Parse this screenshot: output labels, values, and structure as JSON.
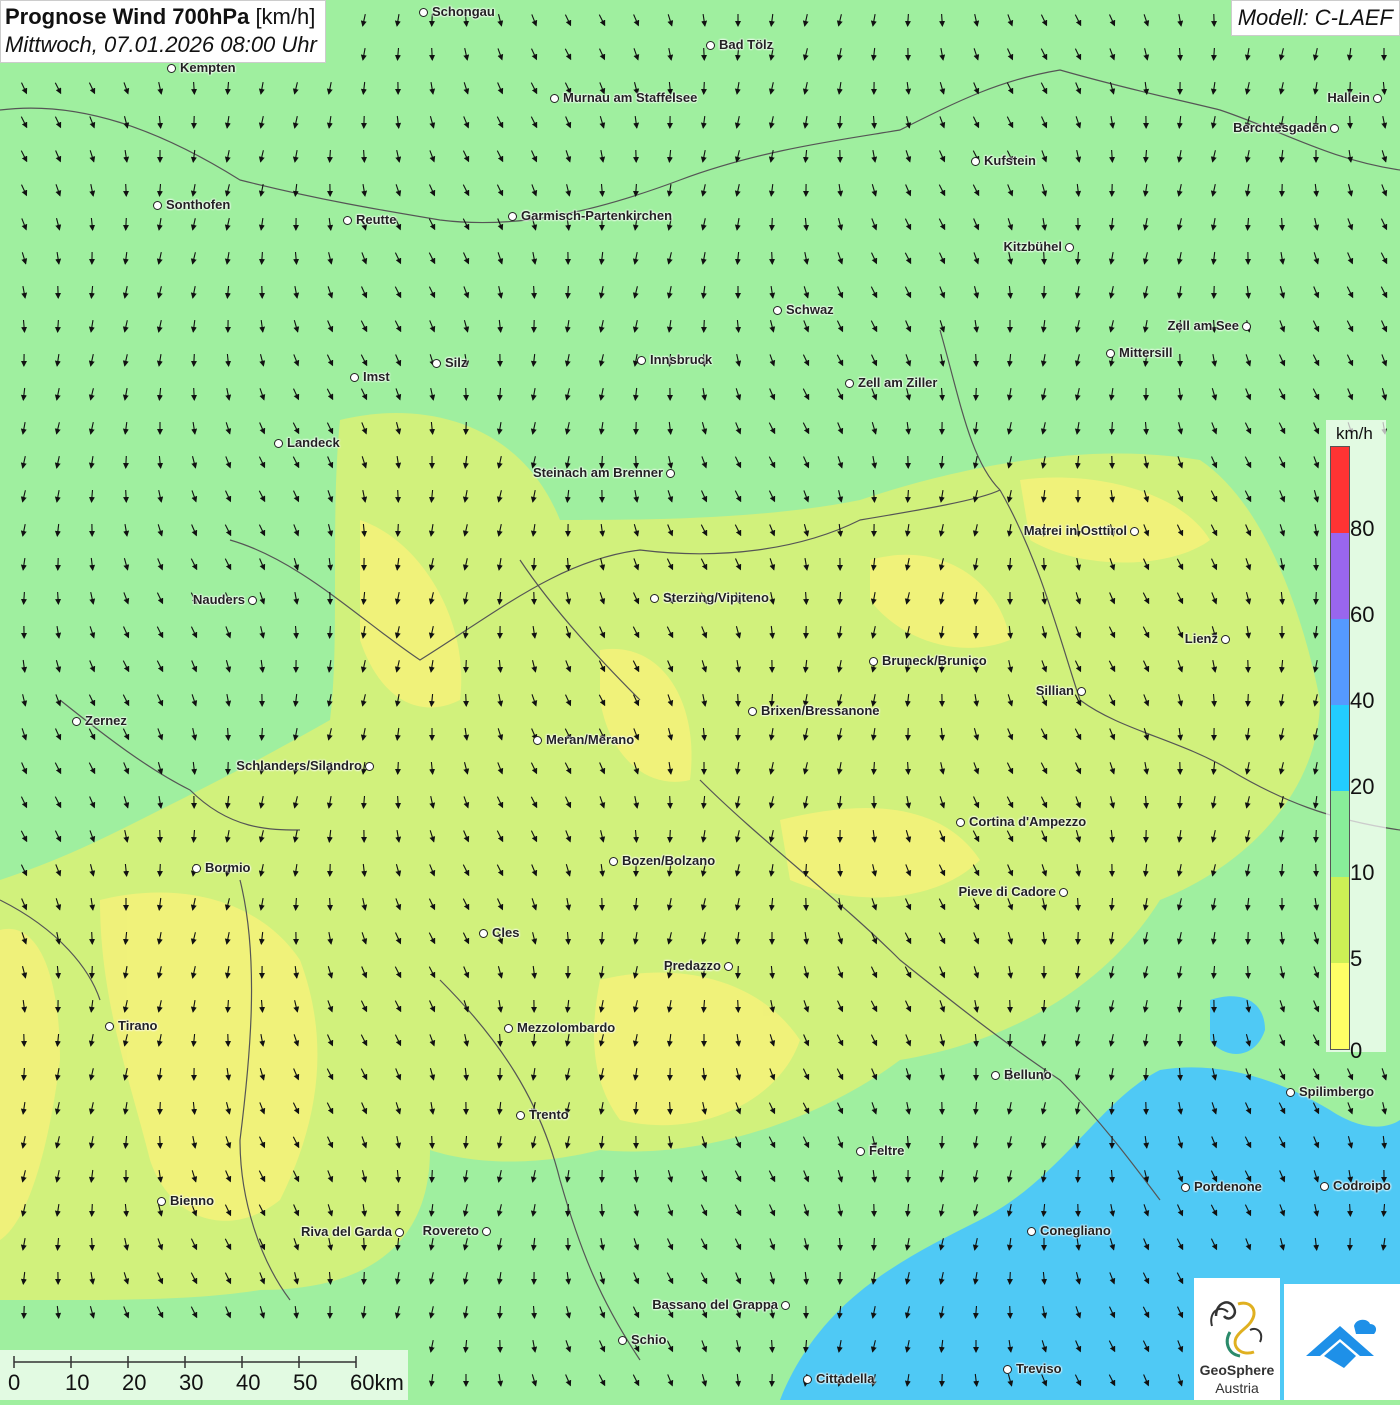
{
  "header": {
    "title_bold": "Prognose Wind 700hPa",
    "title_unit": "[km/h]",
    "subtitle": "Mittwoch, 07.01.2026 08:00 Uhr",
    "model": "Modell: C-LAEF"
  },
  "legend": {
    "title": "km/h",
    "ticks": [
      "80",
      "60",
      "40",
      "20",
      "10",
      "5",
      "0"
    ],
    "colors": [
      "#ff3333",
      "#9966ee",
      "#5599ff",
      "#22ccff",
      "#88ee99",
      "#ccf055",
      "#ffff66"
    ]
  },
  "scalebar": {
    "labels": [
      "0",
      "10",
      "20",
      "30",
      "40",
      "50",
      "60km"
    ]
  },
  "cities": [
    {
      "name": "Schongau"
    },
    {
      "name": "Bad Tölz"
    },
    {
      "name": "Kempten"
    },
    {
      "name": "Murnau am Staffelsee"
    },
    {
      "name": "Hallein"
    },
    {
      "name": "Berchtesgaden"
    },
    {
      "name": "Kufstein"
    },
    {
      "name": "Sonthofen"
    },
    {
      "name": "Reutte"
    },
    {
      "name": "Garmisch-Partenkirchen"
    },
    {
      "name": "Kitzbühel"
    },
    {
      "name": "Schwaz"
    },
    {
      "name": "Zell am See"
    },
    {
      "name": "Mittersill"
    },
    {
      "name": "Innsbruck"
    },
    {
      "name": "Silz"
    },
    {
      "name": "Imst"
    },
    {
      "name": "Zell am Ziller"
    },
    {
      "name": "Landeck"
    },
    {
      "name": "Steinach am Brenner"
    },
    {
      "name": "Matrei in Osttirol"
    },
    {
      "name": "Nauders"
    },
    {
      "name": "Sterzing/Vipiteno"
    },
    {
      "name": "Lienz"
    },
    {
      "name": "Bruneck/Brunico"
    },
    {
      "name": "Sillian"
    },
    {
      "name": "Zernez"
    },
    {
      "name": "Brixen/Bressanone"
    },
    {
      "name": "Meran/Merano"
    },
    {
      "name": "Schlanders/Silandro"
    },
    {
      "name": "Cortina d'Ampezzo"
    },
    {
      "name": "Bozen/Bolzano"
    },
    {
      "name": "Bormio"
    },
    {
      "name": "Pieve di Cadore"
    },
    {
      "name": "Cles"
    },
    {
      "name": "Predazzo"
    },
    {
      "name": "Tirano"
    },
    {
      "name": "Mezzolombardo"
    },
    {
      "name": "Belluno"
    },
    {
      "name": "Spilimbergo"
    },
    {
      "name": "Trento"
    },
    {
      "name": "Feltre"
    },
    {
      "name": "Bienno"
    },
    {
      "name": "Pordenone"
    },
    {
      "name": "Codroipo"
    },
    {
      "name": "Riva del Garda"
    },
    {
      "name": "Rovereto"
    },
    {
      "name": "Conegliano"
    },
    {
      "name": "Bassano del Grappa"
    },
    {
      "name": "Schio"
    },
    {
      "name": "Treviso"
    },
    {
      "name": "Cittadella"
    }
  ],
  "logo": {
    "name_line1": "GeoSphere",
    "name_line2": "Austria"
  },
  "colors": {
    "wind_10_20": "#9fef9f",
    "wind_5_10": "#d4f07a",
    "wind_0_5": "#f3f27a",
    "wind_20_40": "#4fc9f5",
    "arrow": "#111111",
    "border": "#555555"
  }
}
